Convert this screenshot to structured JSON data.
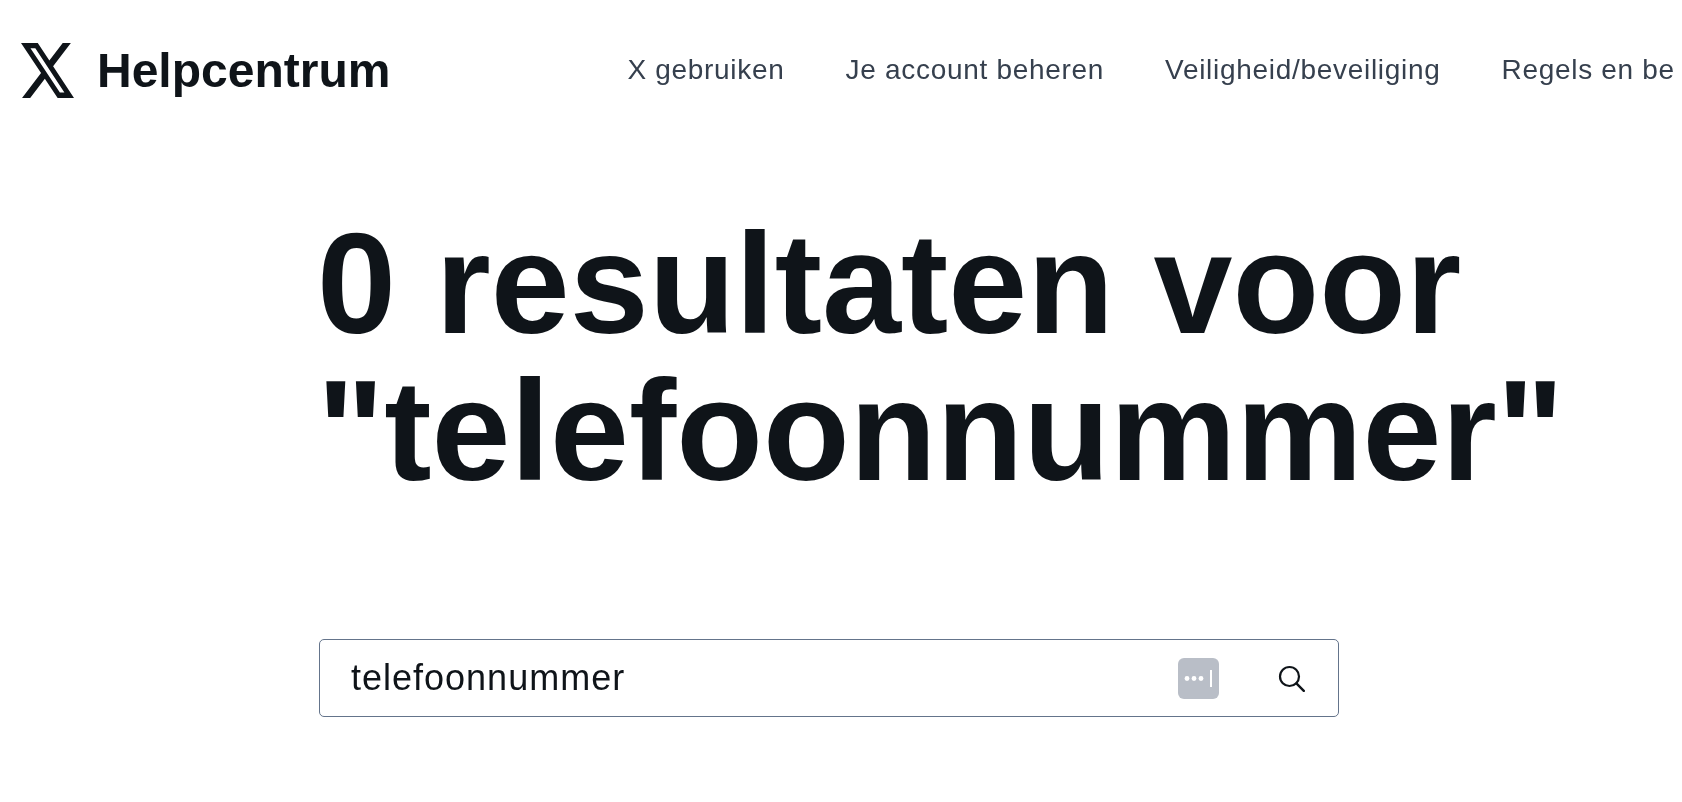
{
  "header": {
    "title": "Helpcentrum",
    "nav": [
      "X gebruiken",
      "Je account beheren",
      "Veiligheid/beveiliging",
      "Regels en be"
    ]
  },
  "heading": "0 resultaten voor \"telefoonnummer\"",
  "search": {
    "value": "telefoonnummer"
  }
}
